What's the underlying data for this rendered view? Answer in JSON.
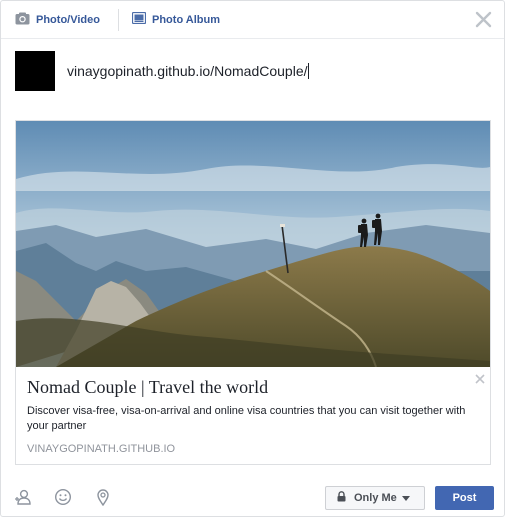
{
  "tabs": {
    "photo_video": "Photo/Video",
    "photo_album": "Photo Album"
  },
  "composer": {
    "input_value": "vinaygopinath.github.io/NomadCouple/"
  },
  "link_preview": {
    "title": "Nomad Couple | Travel the world",
    "description": "Discover visa-free, visa-on-arrival and online visa countries that you can visit together with your partner",
    "domain": "VINAYGOPINATH.GITHUB.IO",
    "image": "mountain-hikers-photo"
  },
  "footer": {
    "privacy_label": "Only Me",
    "post_label": "Post",
    "icons": [
      "tag-people-icon",
      "feeling-icon",
      "location-icon"
    ]
  },
  "colors": {
    "link_blue": "#365899",
    "post_button": "#4267b2",
    "border": "#dddfe2",
    "muted_text": "#90949c"
  }
}
